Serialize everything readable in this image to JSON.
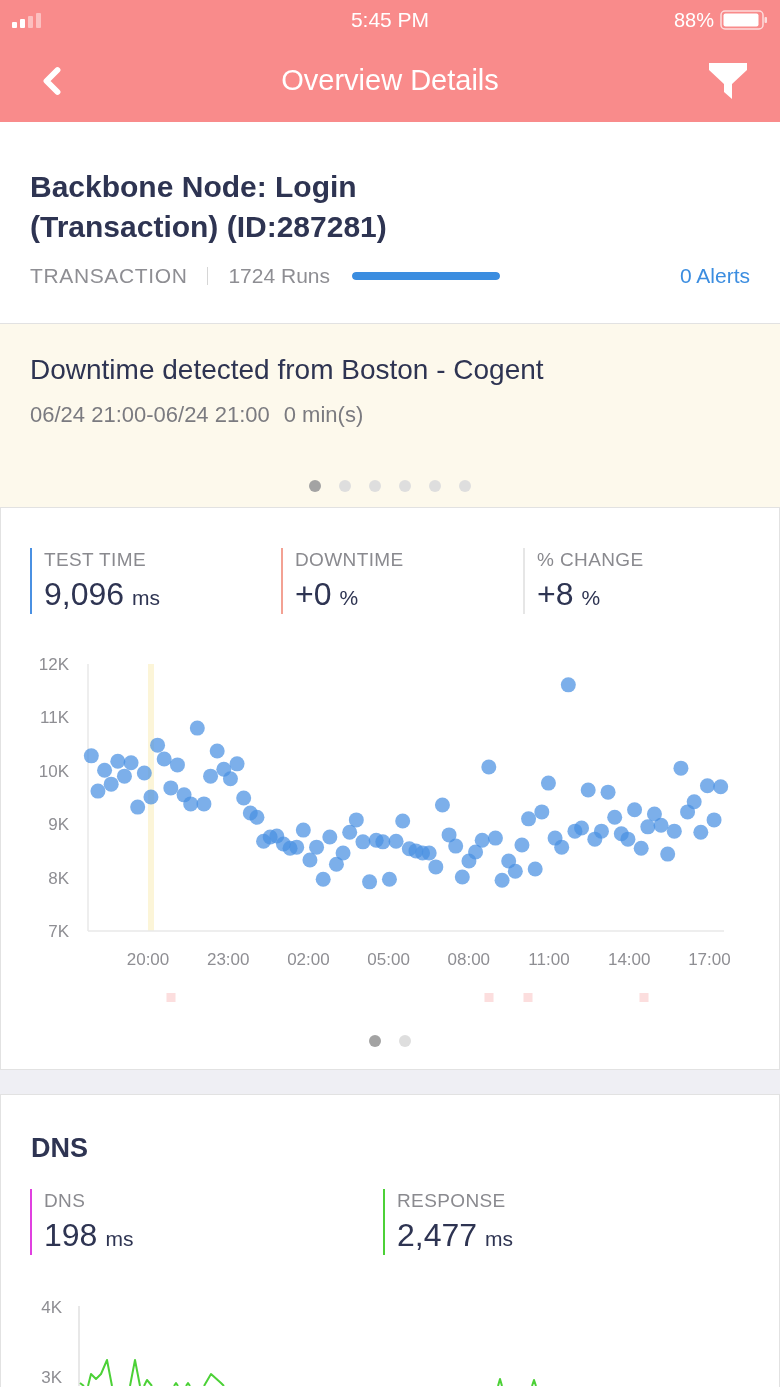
{
  "status_bar": {
    "time": "5:45 PM",
    "battery": "88%"
  },
  "nav": {
    "title": "Overview Details"
  },
  "test": {
    "title": "Backbone Node: Login (Transaction) (ID:287281)",
    "type": "TRANSACTION",
    "runs": "1724 Runs",
    "runs_bar": {
      "level": 1
    },
    "alerts": "0 Alerts"
  },
  "alert": {
    "title": "Downtime detected from Boston - Cogent",
    "period": "06/24 21:00-06/24 21:00",
    "duration": "0 min(s)",
    "pages": [
      {
        "selected": true
      },
      {
        "selected": false
      },
      {
        "selected": false
      },
      {
        "selected": false
      },
      {
        "selected": false
      },
      {
        "selected": false
      }
    ]
  },
  "overview": {
    "metrics": [
      {
        "label": "TEST TIME",
        "value": "9,096",
        "unit": "ms",
        "color": "#4a90e2"
      },
      {
        "label": "DOWNTIME",
        "value": "+0",
        "unit": "%",
        "color": "#f3a193"
      },
      {
        "label": "% CHANGE",
        "value": "+8",
        "unit": "%",
        "color": "#e6e6e6"
      }
    ],
    "chart_data": {
      "type": "scatter",
      "series": [
        {
          "color": "#4a90e2",
          "values": [
            10280,
            9620,
            10010,
            9750,
            10180,
            9900,
            10150,
            9320,
            9960,
            9510,
            10480,
            10220,
            9680,
            10110,
            9550,
            9380,
            10800,
            9380,
            9900,
            10370,
            10030,
            9850,
            10130,
            9490,
            9210,
            9130,
            8680,
            8760,
            8780,
            8630,
            8550,
            8570,
            8890,
            8330,
            8570,
            7970,
            8760,
            8250,
            8460,
            8850,
            9080,
            8670,
            7920,
            8700,
            8670,
            7970,
            8680,
            9060,
            8540,
            8500,
            8460,
            8460,
            8200,
            9360,
            8800,
            8590,
            8010,
            8310,
            8480,
            8700,
            10070,
            8740,
            7950,
            8310,
            8120,
            8610,
            9100,
            8160,
            9230,
            9770,
            8740,
            8570,
            11610,
            8870,
            8930,
            9640,
            8720,
            8870,
            9600,
            9130,
            8820,
            8720,
            9270,
            8550,
            8950,
            9190,
            8980,
            8440,
            8870,
            10050,
            9230,
            9420,
            8850,
            9720,
            9080,
            9700
          ]
        }
      ],
      "ylim": [
        7000,
        12000
      ],
      "yticks": [
        {
          "value": 12000,
          "label": "12K"
        },
        {
          "value": 11000,
          "label": "11K"
        },
        {
          "value": 10000,
          "label": "10K"
        },
        {
          "value": 9000,
          "label": "9K"
        },
        {
          "value": 8000,
          "label": "8K"
        },
        {
          "value": 7000,
          "label": "7K"
        }
      ]
    },
    "x_axis_labels": [
      "20:00",
      "23:00",
      "02:00",
      "05:00",
      "08:00",
      "11:00",
      "14:00",
      "17:00"
    ],
    "pages": [
      {
        "selected": true
      },
      {
        "selected": false
      }
    ]
  },
  "dns": {
    "title": "DNS",
    "metrics": [
      {
        "label": "DNS",
        "value": "198",
        "unit": "ms",
        "color": "#e040e0"
      },
      {
        "label": "RESPONSE",
        "value": "2,477",
        "unit": "ms",
        "color": "#4cd137"
      }
    ],
    "chart": {
      "y_labels": [
        "4K",
        "3K"
      ]
    }
  }
}
